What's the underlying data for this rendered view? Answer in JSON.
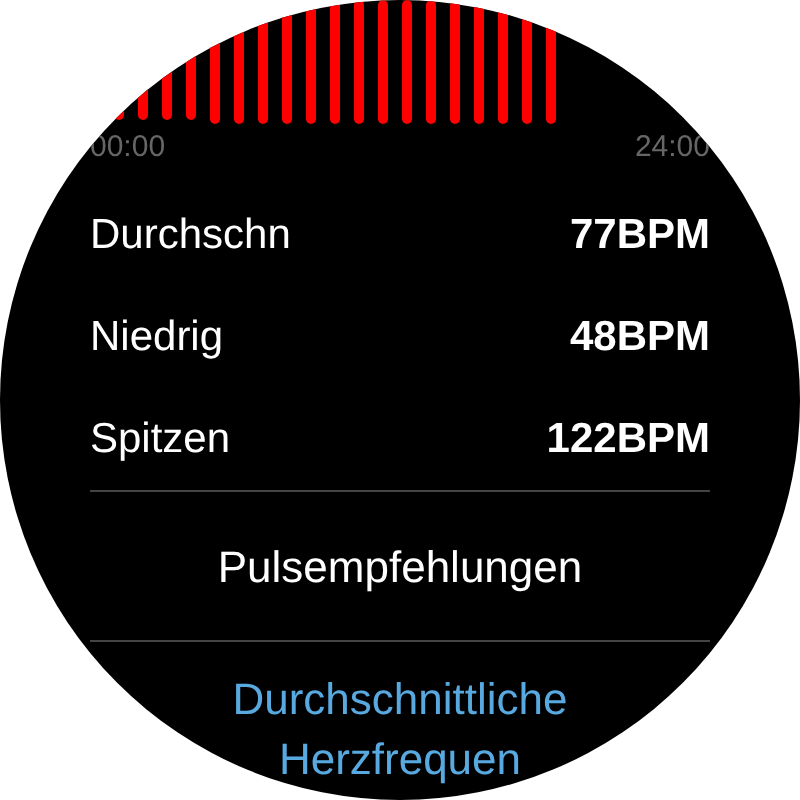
{
  "chart": {
    "x_start_label": "00:00",
    "x_end_label": "24:00"
  },
  "stats": [
    {
      "label": "Durchschn",
      "value": "77BPM"
    },
    {
      "label": "Niedrig",
      "value": "48BPM"
    },
    {
      "label": "Spitzen",
      "value": "122BPM"
    }
  ],
  "menu_item": "Pulsempfehlungen",
  "link_lines": [
    "Durchschnittliche",
    "Herzfrequen"
  ]
}
